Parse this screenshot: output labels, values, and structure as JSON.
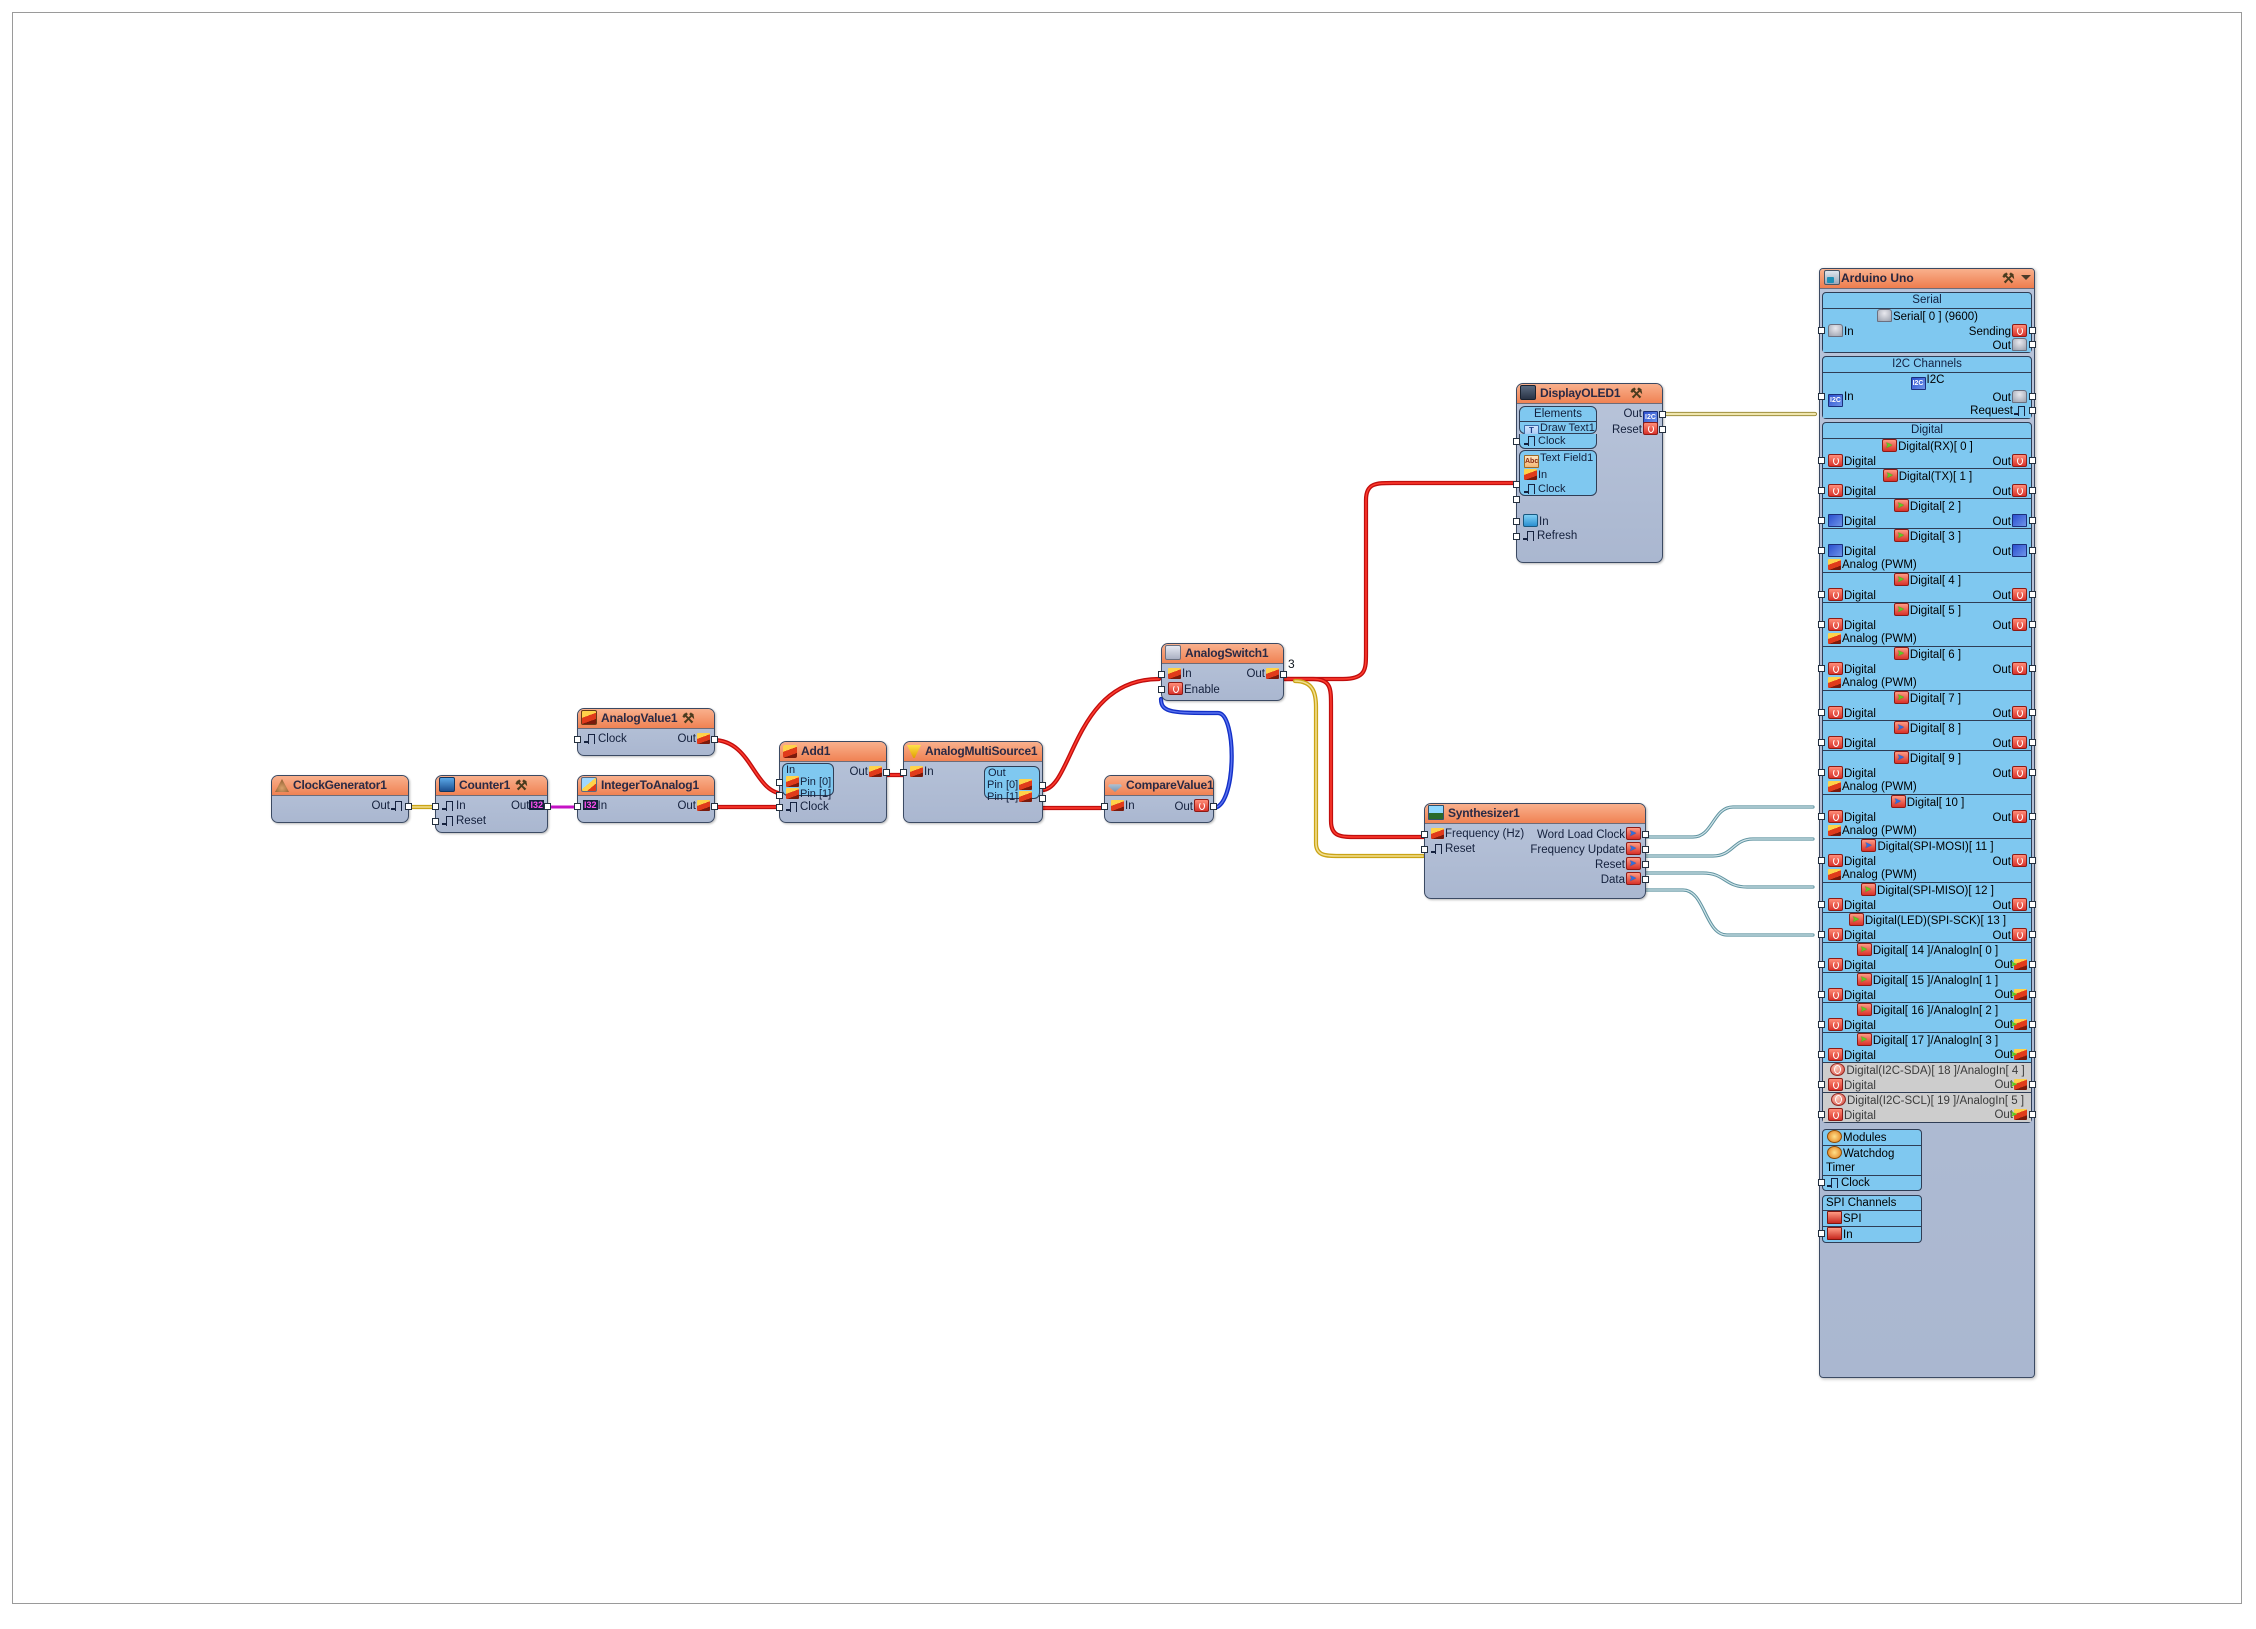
{
  "app": {
    "canvas_label": "flowcode-canvas"
  },
  "nodes": {
    "clockgen": {
      "title": "ClockGenerator1",
      "out": "Out"
    },
    "counter": {
      "title": "Counter1",
      "in": "In",
      "reset": "Reset",
      "out": "Out",
      "out_type": "I32"
    },
    "int2analog": {
      "title": "IntegerToAnalog1",
      "in": "In",
      "in_type": "I32",
      "out": "Out"
    },
    "analogvalue": {
      "title": "AnalogValue1",
      "clock": "Clock",
      "out": "Out"
    },
    "add": {
      "title": "Add1",
      "group": "In",
      "pin0": "Pin [0]",
      "pin1": "Pin [1]",
      "clock": "Clock",
      "out": "Out"
    },
    "multisource": {
      "title": "AnalogMultiSource1",
      "in": "In",
      "group": "Out",
      "pin0": "Pin [0]",
      "pin1": "Pin [1]"
    },
    "comparevalue": {
      "title": "CompareValue1",
      "in": "In",
      "out": "Out"
    },
    "analogswitch": {
      "title": "AnalogSwitch1",
      "in": "In",
      "enable": "Enable",
      "out": "Out",
      "out_badge": "3"
    },
    "oled": {
      "title": "DisplayOLED1",
      "elements": "Elements",
      "drawtext": "Draw Text1",
      "drawtext_clock": "Clock",
      "textfield": "Text Field1",
      "textfield_in": "In",
      "textfield_clock": "Clock",
      "in": "In",
      "refresh": "Refresh",
      "out": "Out",
      "reset": "Reset"
    },
    "synth": {
      "title": "Synthesizer1",
      "freq": "Frequency (Hz)",
      "reset": "Reset",
      "word_load_clock": "Word Load Clock",
      "frequency_update": "Frequency Update",
      "out_reset": "Reset",
      "data": "Data"
    }
  },
  "arduino": {
    "title": "Arduino Uno",
    "serial": {
      "header": "Serial",
      "channel": "Serial[ 0 ] (9600)",
      "in": "In",
      "sending": "Sending",
      "out": "Out"
    },
    "i2c": {
      "header": "I2C Channels",
      "channel": "I2C",
      "in": "In",
      "out": "Out",
      "request": "Request"
    },
    "digital_header": "Digital",
    "in_label": "Digital",
    "out_label": "Out",
    "analog_pwm_label": "Analog (PWM)",
    "pins": [
      {
        "name": "Digital(RX)[ 0 ]",
        "icon": "green-arrow-icon",
        "out_icon": "digital-icon",
        "in_icon": "digital-icon",
        "pwm": false,
        "disabled": false
      },
      {
        "name": "Digital(TX)[ 1 ]",
        "icon": "green-arrow-icon",
        "out_icon": "digital-icon",
        "in_icon": "digital-icon",
        "pwm": false,
        "disabled": false
      },
      {
        "name": "Digital[ 2 ]",
        "icon": "green-arrow-icon",
        "out_icon": "wave-icon",
        "in_icon": "wave-icon",
        "pwm": false,
        "disabled": false
      },
      {
        "name": "Digital[ 3 ]",
        "icon": "green-arrow-icon",
        "out_icon": "wave-icon",
        "in_icon": "wave-icon",
        "pwm": true,
        "disabled": false
      },
      {
        "name": "Digital[ 4 ]",
        "icon": "green-arrow-icon",
        "out_icon": "digital-icon",
        "in_icon": "digital-icon",
        "pwm": false,
        "disabled": false
      },
      {
        "name": "Digital[ 5 ]",
        "icon": "green-arrow-icon",
        "out_icon": "digital-icon",
        "in_icon": "digital-icon",
        "pwm": true,
        "disabled": false
      },
      {
        "name": "Digital[ 6 ]",
        "icon": "green-arrow-icon",
        "out_icon": "digital-icon",
        "in_icon": "digital-icon",
        "pwm": true,
        "disabled": false
      },
      {
        "name": "Digital[ 7 ]",
        "icon": "green-arrow-icon",
        "out_icon": "digital-icon",
        "in_icon": "digital-icon",
        "pwm": false,
        "disabled": false
      },
      {
        "name": "Digital[ 8 ]",
        "icon": "blue-arrow-icon",
        "out_icon": "digital-icon",
        "in_icon": "digital-icon",
        "pwm": false,
        "disabled": false
      },
      {
        "name": "Digital[ 9 ]",
        "icon": "blue-arrow-icon",
        "out_icon": "digital-icon",
        "in_icon": "digital-icon",
        "pwm": true,
        "disabled": false
      },
      {
        "name": "Digital[ 10 ]",
        "icon": "blue-arrow-icon",
        "out_icon": "digital-icon",
        "in_icon": "digital-icon",
        "pwm": true,
        "disabled": false
      },
      {
        "name": "Digital(SPI-MOSI)[ 11 ]",
        "icon": "blue-arrow-icon",
        "out_icon": "digital-icon",
        "in_icon": "digital-icon",
        "pwm": true,
        "disabled": false
      },
      {
        "name": "Digital(SPI-MISO)[ 12 ]",
        "icon": "green-arrow-icon",
        "out_icon": "digital-icon",
        "in_icon": "digital-icon",
        "pwm": false,
        "disabled": false
      },
      {
        "name": "Digital(LED)(SPI-SCK)[ 13 ]",
        "icon": "green-arrow-icon",
        "out_icon": "digital-icon",
        "in_icon": "digital-icon",
        "pwm": false,
        "disabled": false
      },
      {
        "name": "Digital[ 14 ]/AnalogIn[ 0 ]",
        "icon": "green-arrow-icon",
        "out_icon": "analog-icon",
        "in_icon": "digital-icon",
        "pwm": false,
        "disabled": false
      },
      {
        "name": "Digital[ 15 ]/AnalogIn[ 1 ]",
        "icon": "green-arrow-icon",
        "out_icon": "analog-icon",
        "in_icon": "digital-icon",
        "pwm": false,
        "disabled": false
      },
      {
        "name": "Digital[ 16 ]/AnalogIn[ 2 ]",
        "icon": "green-arrow-icon",
        "out_icon": "analog-icon",
        "in_icon": "digital-icon",
        "pwm": false,
        "disabled": false
      },
      {
        "name": "Digital[ 17 ]/AnalogIn[ 3 ]",
        "icon": "green-arrow-icon",
        "out_icon": "analog-icon",
        "in_icon": "digital-icon",
        "pwm": false,
        "disabled": false
      },
      {
        "name": "Digital(I2C-SDA)[ 18 ]/AnalogIn[ 4 ]",
        "icon": "disabled-icon",
        "out_icon": "analog-icon",
        "in_icon": "digital-icon",
        "pwm": false,
        "disabled": true
      },
      {
        "name": "Digital(I2C-SCL)[ 19 ]/AnalogIn[ 5 ]",
        "icon": "disabled-icon",
        "out_icon": "analog-icon",
        "in_icon": "digital-icon",
        "pwm": false,
        "disabled": true
      }
    ],
    "modules": {
      "header": "Modules",
      "watchdog": "Watchdog Timer",
      "clock": "Clock"
    },
    "spi": {
      "header": "SPI Channels",
      "channel": "SPI",
      "in": "In"
    }
  },
  "colors": {
    "node_title": "#f08253",
    "node_body": "#aab7d0",
    "group_fill": "#7fc8f0",
    "wire_red": "#c10e0e",
    "wire_gold": "#caa417",
    "wire_blue": "#1330c8",
    "wire_teal": "#5f93a0",
    "wire_khaki": "#9f8f3e",
    "wire_magenta": "#c512c5",
    "disabled_row": "#cdcdcd"
  }
}
